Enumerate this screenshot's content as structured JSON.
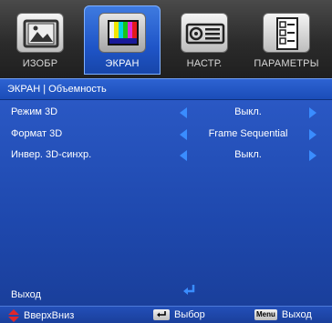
{
  "tabs": [
    {
      "label": "ИЗОБР",
      "icon": "picture-icon",
      "active": false
    },
    {
      "label": "ЭКРАН",
      "icon": "screen-color-bars-icon",
      "active": true
    },
    {
      "label": "НАСТР.",
      "icon": "projector-settings-icon",
      "active": false
    },
    {
      "label": "ПАРАМЕТРЫ",
      "icon": "options-list-icon",
      "active": false
    }
  ],
  "breadcrumb": "ЭКРАН | Объемность",
  "settings": [
    {
      "name": "Режим 3D",
      "value": "Выкл."
    },
    {
      "name": "Формат 3D",
      "value": "Frame Sequential"
    },
    {
      "name": "Инвер. 3D-синхр.",
      "value": "Выкл."
    }
  ],
  "exit_label": "Выход",
  "footer": {
    "updown_label": "ВверхВниз",
    "select_label": "Выбор",
    "menu_key": "Menu",
    "exit_label": "Выход"
  },
  "colors": {
    "accent": "#1f55c8",
    "arrow": "#3a8dff",
    "updown_icon": "#e0262b",
    "enter_icon": "#3a8dff"
  }
}
